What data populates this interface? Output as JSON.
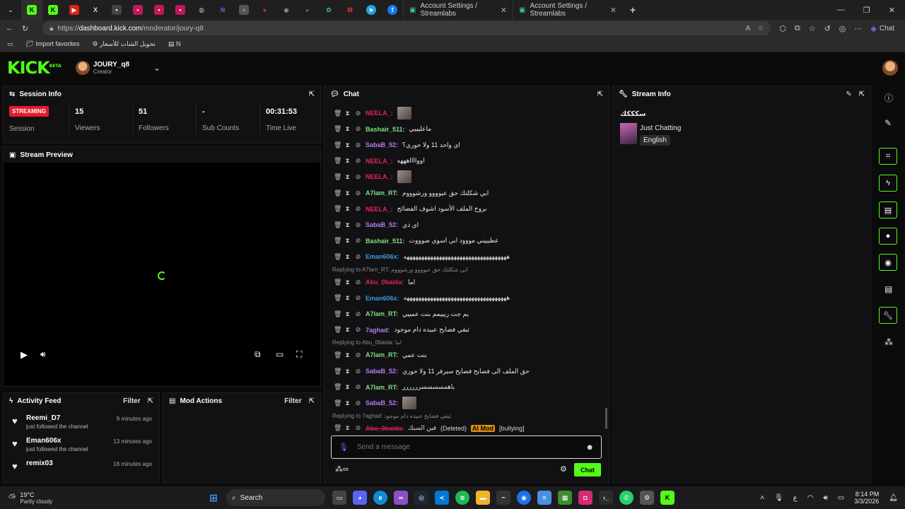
{
  "browser": {
    "tabs": [
      {
        "label": "Account Settings / Streamlabs"
      },
      {
        "label": "Account Settings / Streamlabs"
      }
    ],
    "url_prefix": "https://",
    "url_host": "dashboard.kick.com",
    "url_path": "/moderator/joury-q8",
    "copilot_label": "Chat",
    "favorites": [
      {
        "label": "Import favorites"
      },
      {
        "label": "تحويل الشات للأسعار"
      },
      {
        "label": "N"
      }
    ]
  },
  "header": {
    "logo": "KICK",
    "logo_sup": "BETA",
    "channel_name": "JOURY_q8",
    "channel_role": "Creator"
  },
  "session": {
    "title": "Session Info",
    "status_badge": "STREAMING",
    "session_label": "Session",
    "stats": [
      {
        "value": "15",
        "label": "Viewers"
      },
      {
        "value": "51",
        "label": "Followers"
      },
      {
        "value": "-",
        "label": "Sub Counts"
      },
      {
        "value": "00:31:53",
        "label": "Time Live"
      }
    ]
  },
  "preview": {
    "title": "Stream Preview"
  },
  "activity": {
    "title": "Activity Feed",
    "filter": "Filter",
    "items": [
      {
        "name": "Reemi_D7",
        "action": "just followed the channel",
        "time": "9 minutes ago"
      },
      {
        "name": "Eman606x",
        "action": "just followed the channel",
        "time": "13 minutes ago"
      },
      {
        "name": "remix03",
        "action": "",
        "time": "16 minutes ago"
      }
    ]
  },
  "modactions": {
    "title": "Mod Actions",
    "filter": "Filter"
  },
  "chat": {
    "title": "Chat",
    "messages": [
      {
        "user": "NEELA_:",
        "color": "#e0245e",
        "text": "",
        "emote": true
      },
      {
        "user": "Bashair_511:",
        "color": "#7ee081",
        "text": "ماعليييي"
      },
      {
        "user": "SabaB_52:",
        "color": "#b57cf0",
        "text": "اي واحد 11 ولا حوري؟"
      },
      {
        "user": "NEELA_:",
        "color": "#e0245e",
        "text": "اووااااهههه"
      },
      {
        "user": "NEELA_:",
        "color": "#e0245e",
        "text": "",
        "emote": true
      },
      {
        "user": "A7lam_RT:",
        "color": "#7ee081",
        "text": "ابي شكلتك حق عيوووو ورشوووم"
      },
      {
        "user": "NEELA_:",
        "color": "#e0245e",
        "text": "بروح الملف الأسود اشوف الفضائح"
      },
      {
        "user": "SabaB_52:",
        "color": "#b57cf0",
        "text": "اي ذي"
      },
      {
        "user": "Bashair_511:",
        "color": "#7ee081",
        "text": "عطيييني مووود ابي اسوي صوووت"
      },
      {
        "user": "Eman606x:",
        "color": "#3b9ae1",
        "text": "هههههههههههههههههههههههههههههههههههه"
      },
      {
        "reply": "Replying to A7lam_RT: ابي شكلتك حق عيوووو ورشوووم"
      },
      {
        "user": "Abu_0baida:",
        "color": "#e0245e",
        "text": "اما"
      },
      {
        "user": "Eman606x:",
        "color": "#3b9ae1",
        "text": "هههههههههههههههههههههههههههههههههههه"
      },
      {
        "user": "A7lam_RT:",
        "color": "#7ee081",
        "text": "يم جت ريييمم بنت عمييي"
      },
      {
        "user": "7aghad:",
        "color": "#b57cf0",
        "text": "ثيقي فضايح عبيده دام موجود"
      },
      {
        "reply": "Replying to Abu_0baida: اما"
      },
      {
        "user": "A7lam_RT:",
        "color": "#7ee081",
        "text": "بنت عمي"
      },
      {
        "user": "SabaB_52:",
        "color": "#b57cf0",
        "text": "حق الملف الى فضايح فضايح سيرفر 11 ولا حوري"
      },
      {
        "user": "A7lam_RT:",
        "color": "#7ee081",
        "text": "ياهمسسسسرررررر"
      },
      {
        "user": "SabaB_52:",
        "color": "#b57cf0",
        "text": "",
        "emote": true
      },
      {
        "reply": "Replying to 7aghad: ثيقي فضايح عبيده دام موجود"
      },
      {
        "user": "Abu_0baida:",
        "color": "#e0245e",
        "text": "فين السبك",
        "deleted": "(Deleted)",
        "aimod": "AI Mod",
        "reason": "[bullying]"
      }
    ],
    "input_placeholder": "Send a message",
    "send_label": "Chat"
  },
  "streaminfo": {
    "title": "Stream Info",
    "stream_title": "سكككك",
    "category": "Just Chatting",
    "language": "English"
  },
  "taskbar": {
    "weather_temp": "19°C",
    "weather_desc": "Partly cloudy",
    "search": "Search",
    "time": "8:14 PM",
    "date": "3/3/2026",
    "lang": "ع"
  },
  "colors": {
    "accent": "#53fc18",
    "live": "#e11d2b",
    "bg": "#0b0b0c"
  }
}
